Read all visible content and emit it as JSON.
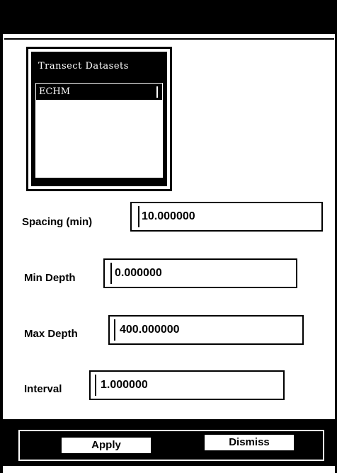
{
  "list": {
    "header": "Transect Datasets",
    "items": [
      "ECHM"
    ]
  },
  "fields": {
    "spacing": {
      "label": "Spacing (min)",
      "value": "10.000000"
    },
    "min_depth": {
      "label": "Min Depth",
      "value": "0.000000"
    },
    "max_depth": {
      "label": "Max Depth",
      "value": "400.000000"
    },
    "interval": {
      "label": "Interval",
      "value": "1.000000"
    }
  },
  "buttons": {
    "apply": "Apply",
    "dismiss": "Dismiss"
  }
}
